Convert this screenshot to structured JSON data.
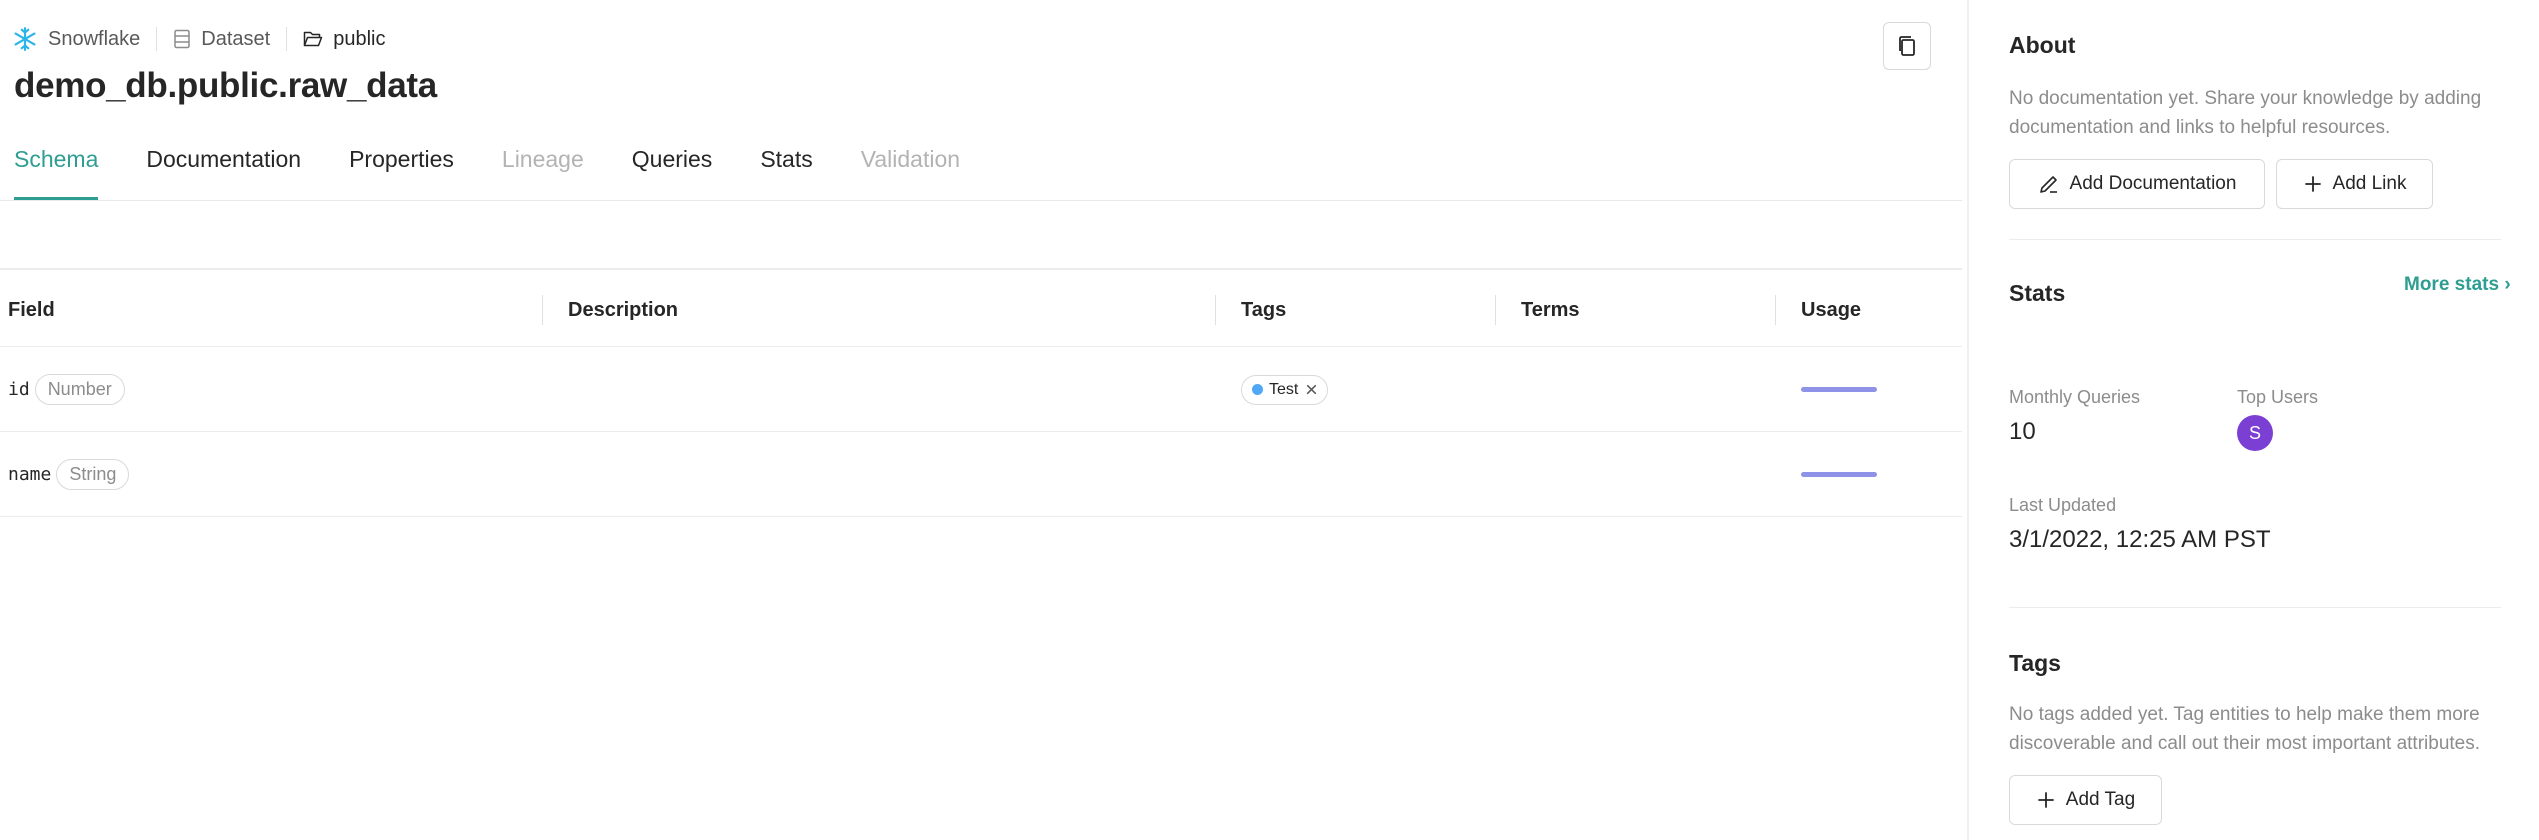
{
  "breadcrumb": {
    "platform": "Snowflake",
    "entity_type": "Dataset",
    "container": "public"
  },
  "page_title": "demo_db.public.raw_data",
  "tabs": [
    {
      "label": "Schema",
      "state": "active"
    },
    {
      "label": "Documentation",
      "state": "enabled"
    },
    {
      "label": "Properties",
      "state": "enabled"
    },
    {
      "label": "Lineage",
      "state": "disabled"
    },
    {
      "label": "Queries",
      "state": "enabled"
    },
    {
      "label": "Stats",
      "state": "enabled"
    },
    {
      "label": "Validation",
      "state": "disabled"
    }
  ],
  "table": {
    "columns": [
      "Field",
      "Description",
      "Tags",
      "Terms",
      "Usage"
    ],
    "rows": [
      {
        "field": "id",
        "type": "Number",
        "tag": "Test",
        "usage_fraction": 1.0
      },
      {
        "field": "name",
        "type": "String",
        "tag": "",
        "usage_fraction": 1.0
      }
    ]
  },
  "sidebar": {
    "about": {
      "title": "About",
      "empty_text": "No documentation yet. Share your knowledge by adding documentation and links to helpful resources.",
      "add_doc_label": "Add Documentation",
      "add_link_label": "Add Link"
    },
    "stats": {
      "title": "Stats",
      "more_label": "More stats",
      "monthly_queries_label": "Monthly Queries",
      "monthly_queries_value": "10",
      "top_users_label": "Top Users",
      "top_user_initial": "S",
      "last_updated_label": "Last Updated",
      "last_updated_value": "3/1/2022, 12:25 AM PST"
    },
    "tags": {
      "title": "Tags",
      "empty_text": "No tags added yet. Tag entities to help make them more discoverable and call out their most important attributes.",
      "add_tag_label": "Add Tag"
    }
  },
  "colors": {
    "accent": "#2f9e92",
    "tag_dot": "#4fa7f6",
    "usage_bar": "#8f93e8",
    "avatar": "#7c3fd4"
  }
}
